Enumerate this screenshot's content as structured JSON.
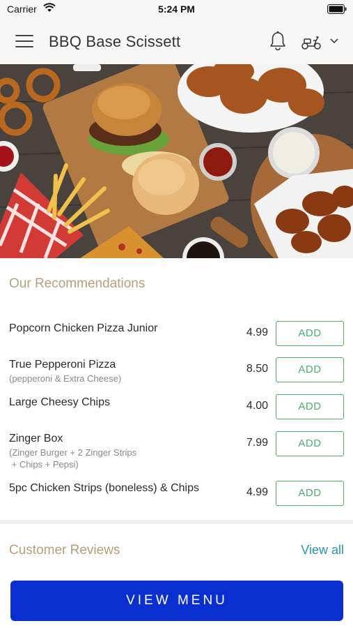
{
  "status_bar": {
    "carrier": "Carrier",
    "time": "5:24 PM"
  },
  "header": {
    "title": "BBQ Base Scissett"
  },
  "recommendations": {
    "title": "Our Recommendations",
    "add_label": "ADD",
    "items": [
      {
        "name": "Popcorn Chicken Pizza Junior",
        "desc": [],
        "price": "4.99"
      },
      {
        "name": "True Pepperoni Pizza",
        "desc": [
          "(pepperoni & Extra Cheese)"
        ],
        "price": "8.50"
      },
      {
        "name": "Large Cheesy Chips",
        "desc": [],
        "price": "4.00"
      },
      {
        "name": "Zinger Box",
        "desc": [
          "(Zinger Burger + 2 Zinger Strips",
          " + Chips + Pepsi)"
        ],
        "price": "7.99"
      },
      {
        "name": "5pc Chicken Strips (boneless) & Chips",
        "desc": [],
        "price": "4.99"
      }
    ]
  },
  "reviews": {
    "title": "Customer Reviews",
    "view_all": "View all"
  },
  "cta": {
    "label": "VIEW MENU"
  },
  "colors": {
    "accent_gold": "#b3a17a",
    "add_green": "#4caf6e",
    "link_blue": "#2e93b8",
    "cta_blue": "#0a2fd1"
  },
  "icons": [
    "wifi-icon",
    "battery-icon",
    "menu-icon",
    "bell-icon",
    "scooter-icon",
    "chevron-down-icon"
  ]
}
